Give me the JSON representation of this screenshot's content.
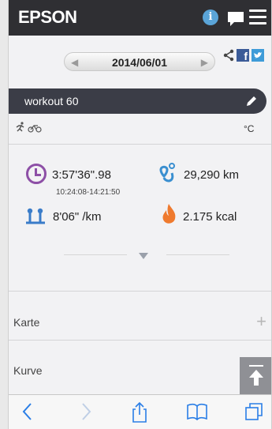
{
  "header": {
    "logo_text": "EPSON",
    "info_icon": "info-icon",
    "info_glyph": "i",
    "chat_icon": "chat-bubble-icon",
    "menu_icon": "hamburger-menu-icon"
  },
  "date_nav": {
    "date": "2014/06/01",
    "prev_icon": "triangle-left-icon",
    "prev_glyph": "◀",
    "next_icon": "triangle-right-icon",
    "next_glyph": "▶"
  },
  "share": {
    "share_icon": "share-icon",
    "facebook_icon": "facebook-icon",
    "facebook_glyph": "f",
    "twitter_icon": "twitter-icon"
  },
  "workout": {
    "title": "workout 60",
    "edit_icon": "pencil-icon",
    "unit_label": "°C"
  },
  "stats": {
    "total_time": "3:57'36\".98",
    "time_range": "10:24:08-14:21:50",
    "distance": "29,290 km",
    "pace": "8'06\" /km",
    "calories": "2.175 kcal"
  },
  "sections": [
    {
      "label": "Karte",
      "icon": "plus-icon",
      "glyph": "+"
    },
    {
      "label": "Kurve",
      "icon": "plus-icon",
      "glyph": "+"
    }
  ],
  "toolbar": {
    "items": [
      "back-icon",
      "forward-icon",
      "share-icon",
      "bookmarks-icon",
      "tabs-icon"
    ]
  },
  "colors": {
    "header_bg": "#2f2f33",
    "title_bar_bg": "#3b3d47",
    "clock_purple": "#8d4fa6",
    "route_blue": "#3a8fd0",
    "flame_orange": "#ef7a2e",
    "ios_blue": "#2a7ee6"
  }
}
